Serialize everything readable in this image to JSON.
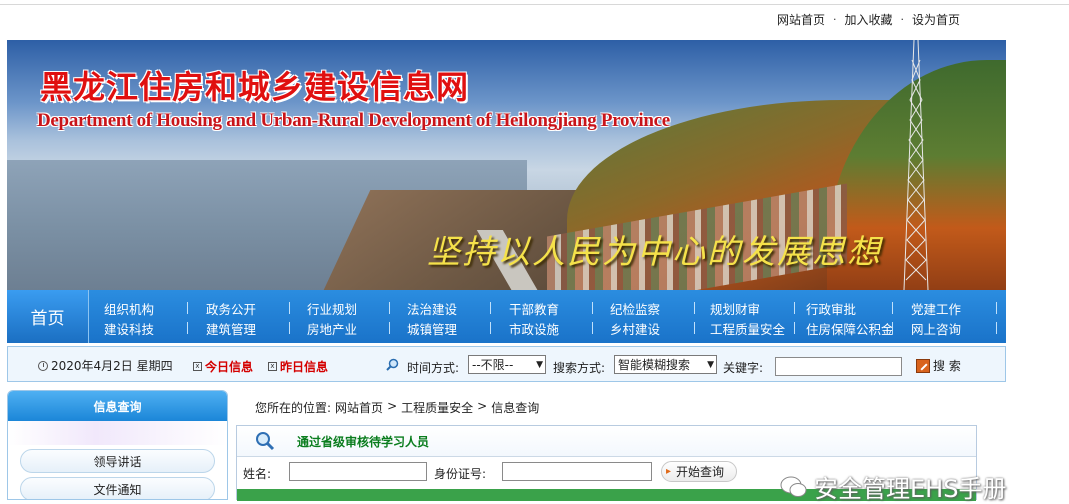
{
  "toplinks": {
    "home": "网站首页",
    "bookmark": "加入收藏",
    "sethome": "设为首页",
    "separator": "·"
  },
  "banner": {
    "title": "黑龙江住房和城乡建设信息网",
    "subtitle": "Department of Housing and Urban-Rural Development of Heilongjiang Province",
    "slogan": "坚持以人民为中心的发展思想"
  },
  "nav": {
    "home": "首页",
    "row1": [
      "组织机构",
      "政务公开",
      "行业规划",
      "法治建设",
      "干部教育",
      "纪检监察",
      "规划财审",
      "行政审批",
      "党建工作"
    ],
    "row2": [
      "建设科技",
      "建筑管理",
      "房地产业",
      "城镇管理",
      "市政设施",
      "乡村建设",
      "工程质量安全",
      "住房保障公积金",
      "网上咨询"
    ],
    "separator": "|"
  },
  "strip": {
    "date": "2020年4月2日 星期四",
    "today": "今日信息",
    "yesterday": "昨日信息",
    "time_label": "时间方式:",
    "time_value": "--不限--",
    "search_label": "搜索方式:",
    "search_value": "智能模糊搜索",
    "keyword_label": "关键字:",
    "keyword_value": "",
    "search_button": "搜 索",
    "xmark": "x",
    "dropdown_arrow": "▼"
  },
  "sidebar": {
    "header": "信息查询",
    "items": [
      "领导讲话",
      "文件通知"
    ]
  },
  "breadcrumb": {
    "prefix": "您所在的位置:",
    "home": "网站首页",
    "sep": ">",
    "section": "工程质量安全",
    "page": "信息查询"
  },
  "panel": {
    "title": "通过省级审核待学习人员",
    "name_label": "姓名:",
    "id_label": "身份证号:",
    "query_button": "开始查询",
    "name_value": "",
    "id_value": ""
  },
  "watermark": {
    "text": "安全管理EHS手册"
  },
  "colors": {
    "nav_blue": "#1a73c9",
    "title_red": "#e01010",
    "slogan_yellow": "#f5e24a",
    "panel_title_green": "#0a7d1e",
    "today_red": "#d40000"
  }
}
